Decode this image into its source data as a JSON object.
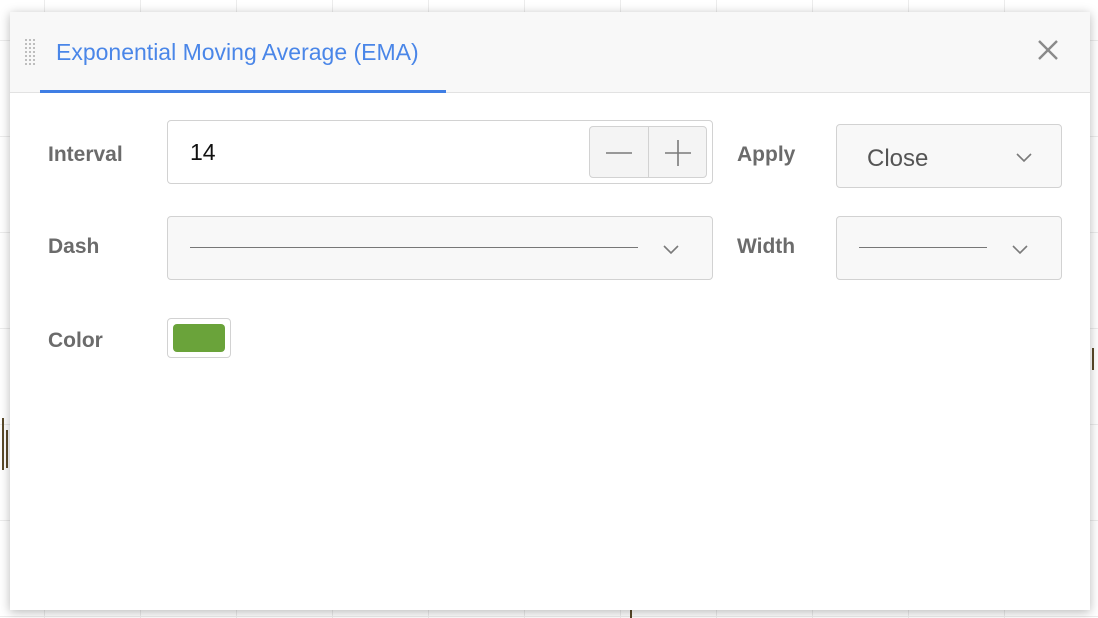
{
  "dialog": {
    "title": "Exponential Moving Average (EMA)",
    "close_icon": "close-icon",
    "drag_icon": "drag-handle-icon"
  },
  "fields": {
    "interval": {
      "label": "Interval",
      "value": "14",
      "decrement_icon": "minus-icon",
      "increment_icon": "plus-icon"
    },
    "apply": {
      "label": "Apply",
      "selected": "Close",
      "icon": "chevron-down-icon"
    },
    "dash": {
      "label": "Dash",
      "selected_style": "solid-line",
      "icon": "chevron-down-icon"
    },
    "width": {
      "label": "Width",
      "selected_style": "thin-line",
      "icon": "chevron-down-icon"
    },
    "color": {
      "label": "Color",
      "value": "#6aa33a"
    }
  },
  "colors": {
    "title_accent": "#4a86e8",
    "tab_underline": "#3f7ee4",
    "label_text": "#6b6b6b"
  }
}
